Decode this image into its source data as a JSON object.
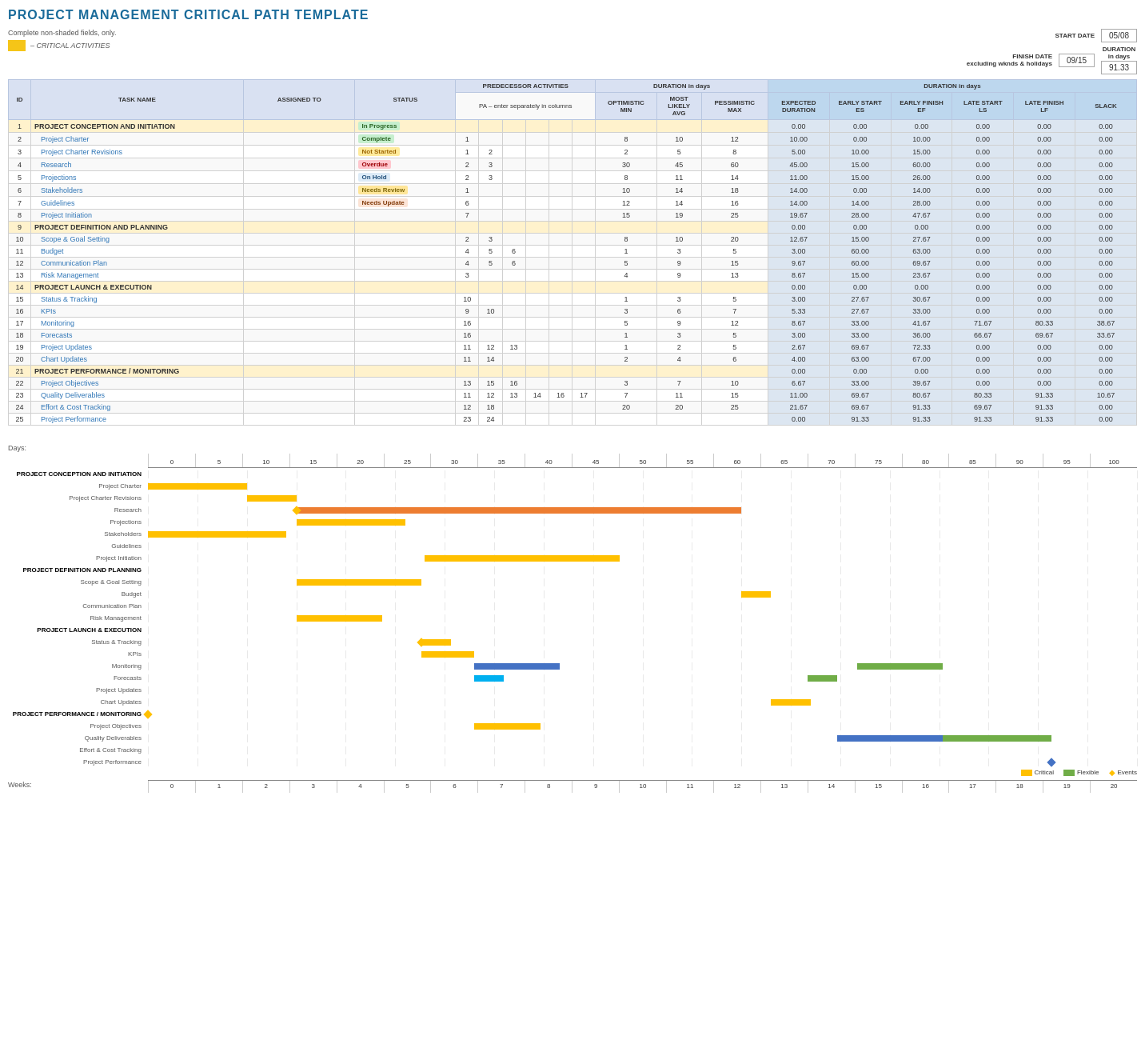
{
  "title": "PROJECT MANAGEMENT CRITICAL PATH TEMPLATE",
  "instructions": "Complete non-shaded fields, only.",
  "critical_legend_label": "– CRITICAL ACTIVITIES",
  "start_date_label": "START DATE",
  "start_date_value": "05/08",
  "finish_date_label": "FINISH DATE\nexcluding wknds & holidays",
  "finish_date_value": "09/15",
  "duration_label": "DURATION\nin days",
  "duration_value": "91.33",
  "table_headers": {
    "id": "ID",
    "task_name": "TASK NAME",
    "assigned_to": "ASSIGNED TO",
    "status": "STATUS",
    "pred_header": "PREDECESSOR ACTIVITIES",
    "pred_sub": "PA – enter separately in columns",
    "optimistic": "OPTIMISTIC\nMIN",
    "most_likely": "MOST LIKELY\nAVG",
    "pessimistic": "PESSIMISTIC\nMAX",
    "duration_header": "DURATION in days",
    "expected": "EXPECTED\nDURATION",
    "early_start": "EARLY START\nES",
    "early_finish": "EARLY FINISH\nEF",
    "late_start": "LATE START\nLS",
    "late_finish": "LATE FINISH\nLF",
    "slack": "SLACK"
  },
  "rows": [
    {
      "id": 1,
      "task": "PROJECT CONCEPTION AND INITIATION",
      "assigned": "",
      "status": "In Progress",
      "status_class": "inprogress",
      "p1": "",
      "p2": "",
      "p3": "",
      "p4": "",
      "p5": "",
      "p6": "",
      "opt": "",
      "ml": "",
      "pess": "",
      "exp_dur": "0.00",
      "es": "0.00",
      "ef": "0.00",
      "ls": "0.00",
      "lf": "0.00",
      "slack": "0.00",
      "section": true
    },
    {
      "id": 2,
      "task": "Project Charter",
      "assigned": "",
      "status": "Complete",
      "status_class": "complete",
      "p1": "1",
      "p2": "",
      "p3": "",
      "p4": "",
      "p5": "",
      "p6": "",
      "opt": "8",
      "ml": "10",
      "pess": "12",
      "exp_dur": "10.00",
      "es": "0.00",
      "ef": "10.00",
      "ls": "0.00",
      "lf": "0.00",
      "slack": "0.00",
      "indent": 1
    },
    {
      "id": 3,
      "task": "Project Charter Revisions",
      "assigned": "",
      "status": "Not Started",
      "status_class": "notstarted",
      "p1": "1",
      "p2": "2",
      "p3": "",
      "p4": "",
      "p5": "",
      "p6": "",
      "opt": "2",
      "ml": "5",
      "pess": "8",
      "exp_dur": "5.00",
      "es": "10.00",
      "ef": "15.00",
      "ls": "0.00",
      "lf": "0.00",
      "slack": "0.00",
      "indent": 1
    },
    {
      "id": 4,
      "task": "Research",
      "assigned": "",
      "status": "Overdue",
      "status_class": "overdue",
      "p1": "2",
      "p2": "3",
      "p3": "",
      "p4": "",
      "p5": "",
      "p6": "",
      "opt": "30",
      "ml": "45",
      "pess": "60",
      "exp_dur": "45.00",
      "es": "15.00",
      "ef": "60.00",
      "ls": "0.00",
      "lf": "0.00",
      "slack": "0.00",
      "indent": 1
    },
    {
      "id": 5,
      "task": "Projections",
      "assigned": "",
      "status": "On Hold",
      "status_class": "onhold",
      "p1": "2",
      "p2": "3",
      "p3": "",
      "p4": "",
      "p5": "",
      "p6": "",
      "opt": "8",
      "ml": "11",
      "pess": "14",
      "exp_dur": "11.00",
      "es": "15.00",
      "ef": "26.00",
      "ls": "0.00",
      "lf": "0.00",
      "slack": "0.00",
      "indent": 1
    },
    {
      "id": 6,
      "task": "Stakeholders",
      "assigned": "",
      "status": "Needs Review",
      "status_class": "needsreview",
      "p1": "1",
      "p2": "",
      "p3": "",
      "p4": "",
      "p5": "",
      "p6": "",
      "opt": "10",
      "ml": "14",
      "pess": "18",
      "exp_dur": "14.00",
      "es": "0.00",
      "ef": "14.00",
      "ls": "0.00",
      "lf": "0.00",
      "slack": "0.00",
      "indent": 1
    },
    {
      "id": 7,
      "task": "Guidelines",
      "assigned": "",
      "status": "Needs Update",
      "status_class": "needsupdate",
      "p1": "6",
      "p2": "",
      "p3": "",
      "p4": "",
      "p5": "",
      "p6": "",
      "opt": "12",
      "ml": "14",
      "pess": "16",
      "exp_dur": "14.00",
      "es": "14.00",
      "ef": "28.00",
      "ls": "0.00",
      "lf": "0.00",
      "slack": "0.00",
      "indent": 1
    },
    {
      "id": 8,
      "task": "Project Initiation",
      "assigned": "",
      "status": "",
      "status_class": "",
      "p1": "7",
      "p2": "",
      "p3": "",
      "p4": "",
      "p5": "",
      "p6": "",
      "opt": "15",
      "ml": "19",
      "pess": "25",
      "exp_dur": "19.67",
      "es": "28.00",
      "ef": "47.67",
      "ls": "0.00",
      "lf": "0.00",
      "slack": "0.00",
      "indent": 1
    },
    {
      "id": 9,
      "task": "PROJECT DEFINITION AND PLANNING",
      "assigned": "",
      "status": "",
      "status_class": "",
      "p1": "",
      "p2": "",
      "p3": "",
      "p4": "",
      "p5": "",
      "p6": "",
      "opt": "",
      "ml": "",
      "pess": "",
      "exp_dur": "0.00",
      "es": "0.00",
      "ef": "0.00",
      "ls": "0.00",
      "lf": "0.00",
      "slack": "0.00",
      "section": true
    },
    {
      "id": 10,
      "task": "Scope & Goal Setting",
      "assigned": "",
      "status": "",
      "status_class": "",
      "p1": "2",
      "p2": "3",
      "p3": "",
      "p4": "",
      "p5": "",
      "p6": "",
      "opt": "8",
      "ml": "10",
      "pess": "20",
      "exp_dur": "12.67",
      "es": "15.00",
      "ef": "27.67",
      "ls": "0.00",
      "lf": "0.00",
      "slack": "0.00",
      "indent": 1
    },
    {
      "id": 11,
      "task": "Budget",
      "assigned": "",
      "status": "",
      "status_class": "",
      "p1": "4",
      "p2": "5",
      "p3": "6",
      "p4": "",
      "p5": "",
      "p6": "",
      "opt": "1",
      "ml": "3",
      "pess": "5",
      "exp_dur": "3.00",
      "es": "60.00",
      "ef": "63.00",
      "ls": "0.00",
      "lf": "0.00",
      "slack": "0.00",
      "indent": 1
    },
    {
      "id": 12,
      "task": "Communication Plan",
      "assigned": "",
      "status": "",
      "status_class": "",
      "p1": "4",
      "p2": "5",
      "p3": "6",
      "p4": "",
      "p5": "",
      "p6": "",
      "opt": "5",
      "ml": "9",
      "pess": "15",
      "exp_dur": "9.67",
      "es": "60.00",
      "ef": "69.67",
      "ls": "0.00",
      "lf": "0.00",
      "slack": "0.00",
      "indent": 1
    },
    {
      "id": 13,
      "task": "Risk Management",
      "assigned": "",
      "status": "",
      "status_class": "",
      "p1": "3",
      "p2": "",
      "p3": "",
      "p4": "",
      "p5": "",
      "p6": "",
      "opt": "4",
      "ml": "9",
      "pess": "13",
      "exp_dur": "8.67",
      "es": "15.00",
      "ef": "23.67",
      "ls": "0.00",
      "lf": "0.00",
      "slack": "0.00",
      "indent": 1
    },
    {
      "id": 14,
      "task": "PROJECT LAUNCH & EXECUTION",
      "assigned": "",
      "status": "",
      "status_class": "",
      "p1": "",
      "p2": "",
      "p3": "",
      "p4": "",
      "p5": "",
      "p6": "",
      "opt": "",
      "ml": "",
      "pess": "",
      "exp_dur": "0.00",
      "es": "0.00",
      "ef": "0.00",
      "ls": "0.00",
      "lf": "0.00",
      "slack": "0.00",
      "section": true
    },
    {
      "id": 15,
      "task": "Status & Tracking",
      "assigned": "",
      "status": "",
      "status_class": "",
      "p1": "10",
      "p2": "",
      "p3": "",
      "p4": "",
      "p5": "",
      "p6": "",
      "opt": "1",
      "ml": "3",
      "pess": "5",
      "exp_dur": "3.00",
      "es": "27.67",
      "ef": "30.67",
      "ls": "0.00",
      "lf": "0.00",
      "slack": "0.00",
      "indent": 1
    },
    {
      "id": 16,
      "task": "KPIs",
      "assigned": "",
      "status": "",
      "status_class": "",
      "p1": "9",
      "p2": "10",
      "p3": "",
      "p4": "",
      "p5": "",
      "p6": "",
      "opt": "3",
      "ml": "6",
      "pess": "7",
      "exp_dur": "5.33",
      "es": "27.67",
      "ef": "33.00",
      "ls": "0.00",
      "lf": "0.00",
      "slack": "0.00",
      "indent": 1
    },
    {
      "id": 17,
      "task": "Monitoring",
      "assigned": "",
      "status": "",
      "status_class": "",
      "p1": "16",
      "p2": "",
      "p3": "",
      "p4": "",
      "p5": "",
      "p6": "",
      "opt": "5",
      "ml": "9",
      "pess": "12",
      "exp_dur": "8.67",
      "es": "33.00",
      "ef": "41.67",
      "ls": "71.67",
      "lf": "80.33",
      "slack": "38.67",
      "indent": 1
    },
    {
      "id": 18,
      "task": "Forecasts",
      "assigned": "",
      "status": "",
      "status_class": "",
      "p1": "16",
      "p2": "",
      "p3": "",
      "p4": "",
      "p5": "",
      "p6": "",
      "opt": "1",
      "ml": "3",
      "pess": "5",
      "exp_dur": "3.00",
      "es": "33.00",
      "ef": "36.00",
      "ls": "66.67",
      "lf": "69.67",
      "slack": "33.67",
      "indent": 1
    },
    {
      "id": 19,
      "task": "Project Updates",
      "assigned": "",
      "status": "",
      "status_class": "",
      "p1": "11",
      "p2": "12",
      "p3": "13",
      "p4": "",
      "p5": "",
      "p6": "",
      "opt": "1",
      "ml": "2",
      "pess": "5",
      "exp_dur": "2.67",
      "es": "69.67",
      "ef": "72.33",
      "ls": "0.00",
      "lf": "0.00",
      "slack": "0.00",
      "indent": 1
    },
    {
      "id": 20,
      "task": "Chart Updates",
      "assigned": "",
      "status": "",
      "status_class": "",
      "p1": "11",
      "p2": "14",
      "p3": "",
      "p4": "",
      "p5": "",
      "p6": "",
      "opt": "2",
      "ml": "4",
      "pess": "6",
      "exp_dur": "4.00",
      "es": "63.00",
      "ef": "67.00",
      "ls": "0.00",
      "lf": "0.00",
      "slack": "0.00",
      "indent": 1
    },
    {
      "id": 21,
      "task": "PROJECT PERFORMANCE / MONITORING",
      "assigned": "",
      "status": "",
      "status_class": "",
      "p1": "",
      "p2": "",
      "p3": "",
      "p4": "",
      "p5": "",
      "p6": "",
      "opt": "",
      "ml": "",
      "pess": "",
      "exp_dur": "0.00",
      "es": "0.00",
      "ef": "0.00",
      "ls": "0.00",
      "lf": "0.00",
      "slack": "0.00",
      "section": true
    },
    {
      "id": 22,
      "task": "Project Objectives",
      "assigned": "",
      "status": "",
      "status_class": "",
      "p1": "13",
      "p2": "15",
      "p3": "16",
      "p4": "",
      "p5": "",
      "p6": "",
      "opt": "3",
      "ml": "7",
      "pess": "10",
      "exp_dur": "6.67",
      "es": "33.00",
      "ef": "39.67",
      "ls": "0.00",
      "lf": "0.00",
      "slack": "0.00",
      "indent": 1
    },
    {
      "id": 23,
      "task": "Quality Deliverables",
      "assigned": "",
      "status": "",
      "status_class": "",
      "p1": "11",
      "p2": "12",
      "p3": "13",
      "p4": "14",
      "p5": "16",
      "p6": "17",
      "opt": "7",
      "ml": "11",
      "pess": "15",
      "exp_dur": "11.00",
      "es": "69.67",
      "ef": "80.67",
      "ls": "80.33",
      "lf": "91.33",
      "slack": "10.67",
      "indent": 1
    },
    {
      "id": 24,
      "task": "Effort & Cost Tracking",
      "assigned": "",
      "status": "",
      "status_class": "",
      "p1": "12",
      "p2": "18",
      "p3": "",
      "p4": "",
      "p5": "",
      "p6": "",
      "opt": "20",
      "ml": "20",
      "pess": "25",
      "exp_dur": "21.67",
      "es": "69.67",
      "ef": "91.33",
      "ls": "69.67",
      "lf": "91.33",
      "slack": "0.00",
      "indent": 1
    },
    {
      "id": 25,
      "task": "Project Performance",
      "assigned": "",
      "status": "",
      "status_class": "",
      "p1": "23",
      "p2": "24",
      "p3": "",
      "p4": "",
      "p5": "",
      "p6": "",
      "opt": "",
      "ml": "",
      "pess": "",
      "exp_dur": "0.00",
      "es": "91.33",
      "ef": "91.33",
      "ls": "91.33",
      "lf": "91.33",
      "slack": "0.00",
      "indent": 1
    }
  ],
  "gantt": {
    "days_label": "Days:",
    "weeks_label": "Weeks:",
    "day_ticks": [
      0,
      5,
      10,
      15,
      20,
      25,
      30,
      35,
      40,
      45,
      50,
      55,
      60,
      65,
      70,
      75,
      80,
      85,
      90,
      95,
      100
    ],
    "week_ticks": [
      0,
      1,
      2,
      3,
      4,
      5,
      6,
      7,
      8,
      9,
      10,
      11,
      12,
      13,
      14,
      15,
      16,
      17,
      18,
      19,
      20
    ],
    "legend_critical": "Critical",
    "legend_flexible": "Flexible",
    "legend_events": "Events",
    "bars": [
      {
        "label": "PROJECT CONCEPTION AND INITIATION",
        "section": true,
        "bars": []
      },
      {
        "label": "Project Charter",
        "bars": [
          {
            "start": 0,
            "end": 10,
            "color": "yellow"
          }
        ]
      },
      {
        "label": "Project Charter Revisions",
        "bars": [
          {
            "start": 10,
            "end": 15,
            "color": "yellow"
          }
        ]
      },
      {
        "label": "Research",
        "bars": [
          {
            "start": 15,
            "end": 60,
            "color": "orange"
          }
        ],
        "diamond": {
          "pos": 15
        }
      },
      {
        "label": "Projections",
        "bars": [
          {
            "start": 15,
            "end": 26,
            "color": "yellow"
          }
        ]
      },
      {
        "label": "Stakeholders",
        "bars": [
          {
            "start": 0,
            "end": 14,
            "color": "yellow"
          }
        ]
      },
      {
        "label": "Guidelines",
        "bars": []
      },
      {
        "label": "Project Initiation",
        "bars": [
          {
            "start": 28,
            "end": 47.67,
            "color": "yellow"
          }
        ]
      },
      {
        "label": "PROJECT DEFINITION AND PLANNING",
        "section": true,
        "bars": []
      },
      {
        "label": "Scope & Goal Setting",
        "bars": [
          {
            "start": 15,
            "end": 27.67,
            "color": "yellow"
          }
        ]
      },
      {
        "label": "Budget",
        "bars": [
          {
            "start": 60,
            "end": 63,
            "color": "yellow"
          }
        ]
      },
      {
        "label": "Communication Plan",
        "bars": []
      },
      {
        "label": "Risk Management",
        "bars": [
          {
            "start": 15,
            "end": 23.67,
            "color": "yellow"
          }
        ]
      },
      {
        "label": "PROJECT LAUNCH & EXECUTION",
        "section": true,
        "bars": []
      },
      {
        "label": "Status & Tracking",
        "bars": [
          {
            "start": 27.67,
            "end": 30.67,
            "color": "yellow"
          }
        ],
        "diamond": {
          "pos": 27.67
        }
      },
      {
        "label": "KPIs",
        "bars": [
          {
            "start": 27.67,
            "end": 33,
            "color": "yellow"
          }
        ]
      },
      {
        "label": "Monitoring",
        "bars": [
          {
            "start": 33,
            "end": 41.67,
            "color": "blue"
          },
          {
            "start": 71.67,
            "end": 80.33,
            "color": "green"
          }
        ]
      },
      {
        "label": "Forecasts",
        "bars": [
          {
            "start": 33,
            "end": 36,
            "color": "lightblue"
          },
          {
            "start": 66.67,
            "end": 69.67,
            "color": "green"
          }
        ]
      },
      {
        "label": "Project Updates",
        "bars": []
      },
      {
        "label": "Chart Updates",
        "bars": [
          {
            "start": 63,
            "end": 67,
            "color": "yellow"
          }
        ]
      },
      {
        "label": "PROJECT PERFORMANCE / MONITORING",
        "section": true,
        "bars": [],
        "diamond": {
          "pos": 0
        }
      },
      {
        "label": "Project Objectives",
        "bars": [
          {
            "start": 33,
            "end": 39.67,
            "color": "yellow"
          }
        ]
      },
      {
        "label": "Quality Deliverables",
        "bars": [
          {
            "start": 69.67,
            "end": 80.67,
            "color": "blue"
          },
          {
            "start": 80.33,
            "end": 91.33,
            "color": "green"
          }
        ]
      },
      {
        "label": "Effort & Cost Tracking",
        "bars": []
      },
      {
        "label": "Project Performance",
        "bars": [],
        "diamond_blue": {
          "pos": 91.33
        }
      }
    ]
  }
}
